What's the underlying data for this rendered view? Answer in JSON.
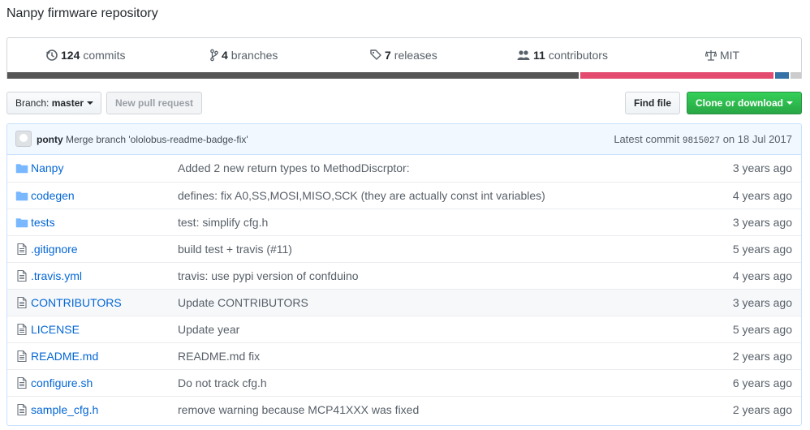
{
  "repo": {
    "description": "Nanpy firmware repository"
  },
  "summary": {
    "commits": {
      "count": "124",
      "label": "commits"
    },
    "branches": {
      "count": "4",
      "label": "branches"
    },
    "releases": {
      "count": "7",
      "label": "releases"
    },
    "contributors": {
      "count": "11",
      "label": "contributors"
    },
    "license": {
      "label": "MIT"
    }
  },
  "language_bar": [
    {
      "color": "#555555",
      "fraction": 0.72
    },
    {
      "color": "#e34c6f",
      "fraction": 0.245
    },
    {
      "color": "#3572a5",
      "fraction": 0.02
    },
    {
      "color": "#cccccc",
      "fraction": 0.015
    }
  ],
  "toolbar": {
    "branch_prefix": "Branch:",
    "branch_name": "master",
    "new_pull_request": "New pull request",
    "find_file": "Find file",
    "clone_download": "Clone or download"
  },
  "latest_commit": {
    "author": "ponty",
    "message": "Merge branch 'ololobus-readme-badge-fix'",
    "prefix": "Latest commit",
    "sha": "9815027",
    "date": "on 18 Jul 2017"
  },
  "files": [
    {
      "type": "dir",
      "name": "Nanpy",
      "message": "Added 2 new return types to MethodDiscrptor:",
      "age": "3 years ago"
    },
    {
      "type": "dir",
      "name": "codegen",
      "message": "defines: fix A0,SS,MOSI,MISO,SCK (they are actually const int variables)",
      "age": "4 years ago"
    },
    {
      "type": "dir",
      "name": "tests",
      "message": "test: simplify cfg.h",
      "age": "3 years ago"
    },
    {
      "type": "file",
      "name": ".gitignore",
      "message": "build test + travis (#11)",
      "age": "5 years ago"
    },
    {
      "type": "file",
      "name": ".travis.yml",
      "message": "travis: use pypi version of confduino",
      "age": "4 years ago"
    },
    {
      "type": "file",
      "name": "CONTRIBUTORS",
      "message": "Update CONTRIBUTORS",
      "age": "3 years ago"
    },
    {
      "type": "file",
      "name": "LICENSE",
      "message": "Update year",
      "age": "5 years ago"
    },
    {
      "type": "file",
      "name": "README.md",
      "message": "README.md fix",
      "age": "2 years ago"
    },
    {
      "type": "file",
      "name": "configure.sh",
      "message": "Do not track cfg.h",
      "age": "6 years ago"
    },
    {
      "type": "file",
      "name": "sample_cfg.h",
      "message": "remove warning because MCP41XXX was fixed",
      "age": "2 years ago"
    }
  ]
}
